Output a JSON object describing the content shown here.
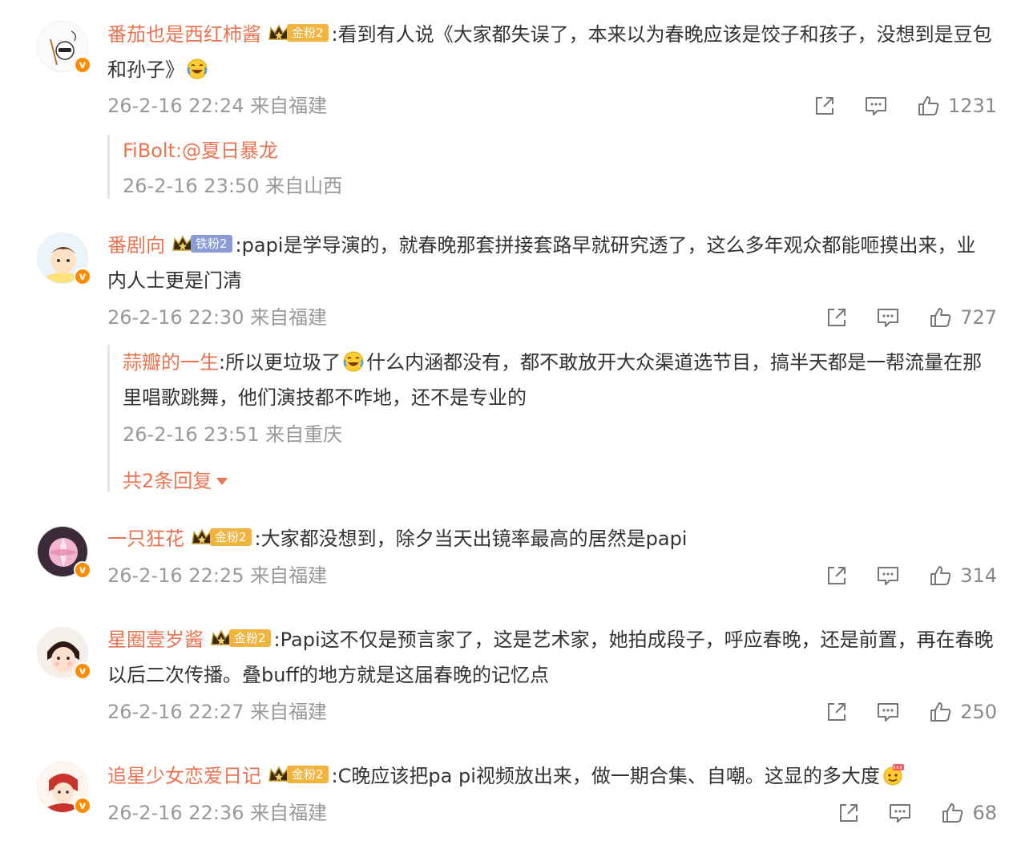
{
  "colors": {
    "username": "#eb7350",
    "meta": "#999999",
    "gold_badge": "#f1b43f",
    "iron_badge": "#8a9bd6",
    "verified": "#ff8c00"
  },
  "comments": [
    {
      "username": "番茄也是西红柿酱",
      "fan_badge": "金粉2",
      "text": ":看到有人说《大家都失误了，本来以为春晚应该是饺子和孩子，没想到是豆包和孙子》",
      "emoji": "laugh-cry-emoji",
      "meta": "26-2-16 22:24 来自福建",
      "likes": "1231",
      "reply": {
        "author": "FiBolt",
        "text": ":@夏日暴龙",
        "meta": "26-2-16 23:50 来自山西"
      }
    },
    {
      "username": "番剧向",
      "fan_badge": "铁粉2",
      "text": ":papi是学导演的，就春晚那套拼接套路早就研究透了，这么多年观众都能咂摸出来，业内人士更是门清",
      "meta": "26-2-16 22:30 来自福建",
      "likes": "727",
      "reply": {
        "author": "蒜瓣的一生",
        "text_before": ":所以更垃圾了",
        "emoji": "laugh-cry-emoji",
        "text_after": "什么内涵都没有，都不敢放开大众渠道选节目，搞半天都是一帮流量在那里唱歌跳舞，他们演技都不咋地，还不是专业的",
        "meta": "26-2-16 23:51 来自重庆"
      },
      "more_replies": "共2条回复"
    },
    {
      "username": "一只狂花",
      "fan_badge": "金粉2",
      "text": ":大家都没想到，除夕当天出镜率最高的居然是papi",
      "meta": "26-2-16 22:25 来自福建",
      "likes": "314"
    },
    {
      "username": "星圈壹岁酱",
      "fan_badge": "金粉2",
      "text": ":Papi这不仅是预言家了，这是艺术家，她拍成段子，呼应春晚，还是前置，再在春晚以后二次传播。叠buff的地方就是这届春晚的记忆点",
      "meta": "26-2-16 22:27 来自福建",
      "likes": "250"
    },
    {
      "username": "追星少女恋爱日记",
      "fan_badge": "金粉2",
      "text": ":C晚应该把pa pi视频放出来，做一期合集、自嘲。这显的多大度",
      "emoji": "666-emoji",
      "meta": "26-2-16 22:36 来自福建",
      "likes": "68"
    }
  ]
}
